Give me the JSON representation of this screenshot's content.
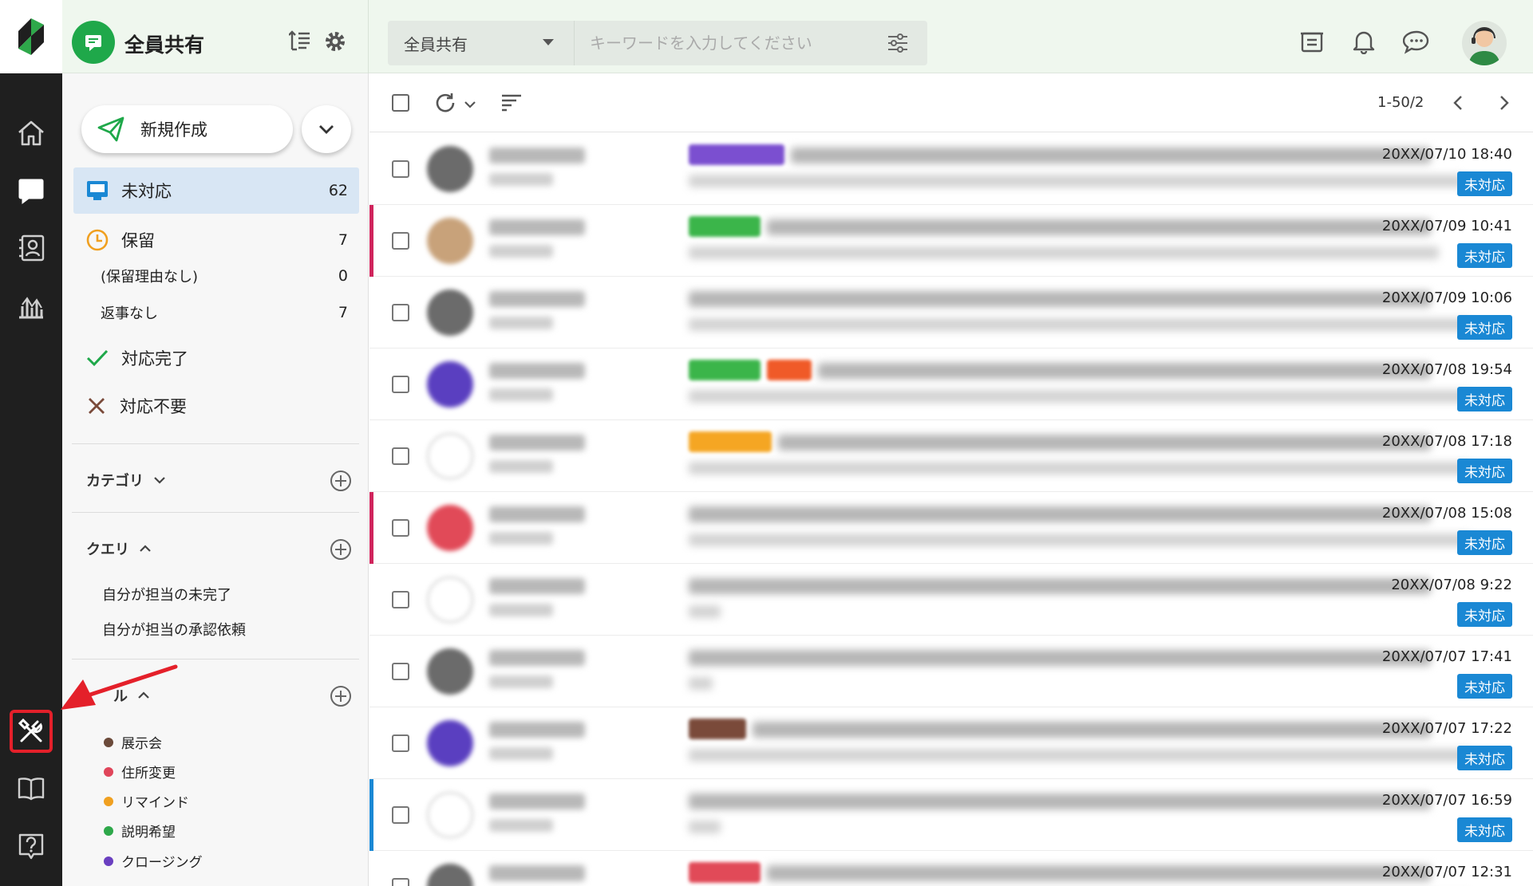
{
  "app": {
    "inbox_title": "全員共有",
    "colors": {
      "brand_green": "#1fa84a",
      "status_blue": "#1a88d4",
      "selected_folder": "#d8e6f4",
      "annotation_red": "#e4202a"
    }
  },
  "search": {
    "scope_label": "全員共有",
    "placeholder": "キーワードを入力してください"
  },
  "top_icons": [
    "notice-board-icon",
    "bell-icon",
    "chat-icon",
    "user-avatar"
  ],
  "rail": {
    "items": [
      "home-icon",
      "inbox-icon",
      "contacts-icon",
      "reports-icon",
      "admin-tools-icon",
      "manual-book-icon",
      "help-icon"
    ],
    "active": "inbox-icon",
    "highlighted": "admin-tools-icon"
  },
  "sidebar": {
    "new_button_label": "新規作成",
    "folders": {
      "unread": {
        "label": "未対応",
        "count": "62"
      },
      "hold": {
        "label": "保留",
        "count": "7"
      },
      "hold_no_reason": {
        "label": "(保留理由なし)",
        "count": "0"
      },
      "no_reply": {
        "label": "返事なし",
        "count": "7"
      },
      "done": {
        "label": "対応完了"
      },
      "not_needed": {
        "label": "対応不要"
      }
    },
    "category_label": "カテゴリ",
    "query_label": "クエリ",
    "queries": [
      "自分が担当の未完了",
      "自分が担当の承認依頼"
    ],
    "label_section_label": "ル",
    "labels": [
      {
        "name": "展示会",
        "color": "#6b4a3a"
      },
      {
        "name": "住所変更",
        "color": "#e0455a"
      },
      {
        "name": "リマインド",
        "color": "#f0a020"
      },
      {
        "name": "説明希望",
        "color": "#2ea84a"
      },
      {
        "name": "クロージング",
        "color": "#6a3fc0"
      }
    ]
  },
  "toolbar": {
    "pager": "1-50/2"
  },
  "messages": [
    {
      "date": "20XX/07/10 18:40",
      "status": "未対応"
    },
    {
      "date": "20XX/07/09 10:41",
      "status": "未対応"
    },
    {
      "date": "20XX/07/09 10:06",
      "status": "未対応"
    },
    {
      "date": "20XX/07/08 19:54",
      "status": "未対応"
    },
    {
      "date": "20XX/07/08 17:18",
      "status": "未対応"
    },
    {
      "date": "20XX/07/08 15:08",
      "status": "未対応"
    },
    {
      "date": "20XX/07/08 9:22",
      "status": "未対応"
    },
    {
      "date": "20XX/07/07 17:41",
      "status": "未対応"
    },
    {
      "date": "20XX/07/07 17:22",
      "status": "未対応"
    },
    {
      "date": "20XX/07/07 16:59",
      "status": "未対応"
    },
    {
      "date": "20XX/07/07 12:31",
      "status": ""
    }
  ]
}
